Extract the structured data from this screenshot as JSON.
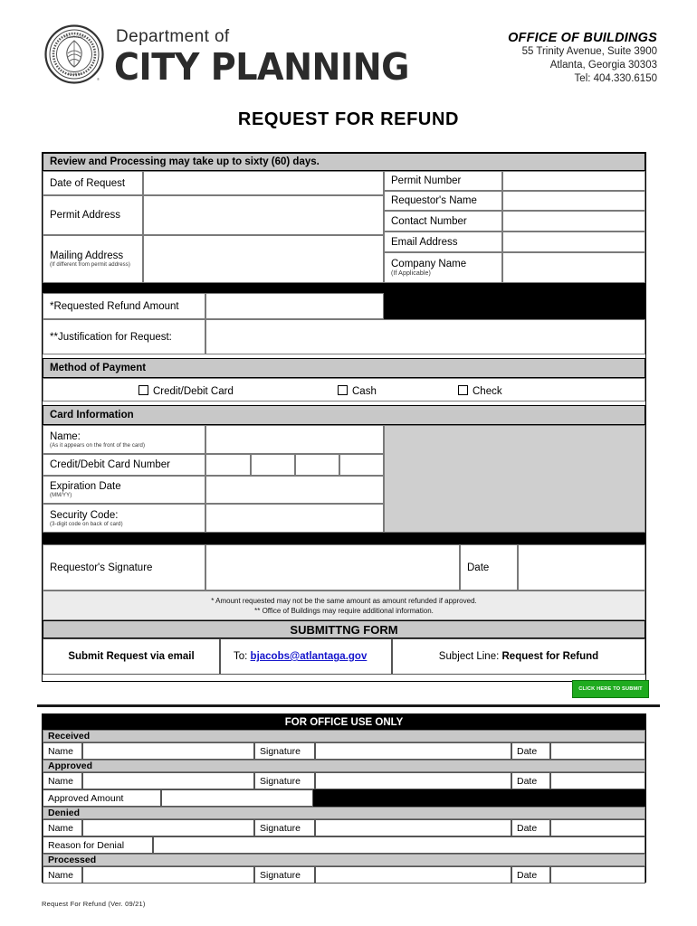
{
  "header": {
    "dept_line": "Department of",
    "dept_name": "CITY PLANNING",
    "seal_icon": "city-of-atlanta-seal-icon",
    "office_title": "OFFICE OF BUILDINGS",
    "address_line1": "55 Trinity Avenue, Suite 3900",
    "address_line2": "Atlanta, Georgia 30303",
    "phone": "Tel: 404.330.6150"
  },
  "form_title": "REQUEST FOR REFUND",
  "notice_band": "Review and Processing may take up to sixty (60) days.",
  "left_fields": [
    {
      "label": "Date of Request",
      "sub": "",
      "value": ""
    },
    {
      "label": "Permit Address",
      "sub": "",
      "value": ""
    },
    {
      "label": "Mailing Address",
      "sub": "(If different from permit address)",
      "value": ""
    }
  ],
  "right_fields": [
    {
      "label": "Permit Number",
      "sub": "",
      "value": ""
    },
    {
      "label": "Requestor's Name",
      "sub": "",
      "value": ""
    },
    {
      "label": "Contact Number",
      "sub": "",
      "value": ""
    },
    {
      "label": "Email Address",
      "sub": "",
      "value": ""
    },
    {
      "label": "Company Name",
      "sub": "(If Applicable)",
      "value": ""
    }
  ],
  "refund": {
    "amount_label": "*Requested Refund Amount",
    "amount_value": "",
    "justification_label": "**Justification for Request:",
    "justification_value": ""
  },
  "payment": {
    "band": "Method of Payment",
    "options": [
      {
        "label": "Credit/Debit Card",
        "checked": false
      },
      {
        "label": "Cash",
        "checked": false
      },
      {
        "label": "Check",
        "checked": false
      }
    ]
  },
  "card": {
    "band": "Card Information",
    "name_label": "Name:",
    "name_sub": "(As it appears on the front of the card)",
    "name_value": "",
    "number_label": "Credit/Debit Card Number",
    "number_groups": [
      "",
      "",
      "",
      ""
    ],
    "expiration_label": "Expiration Date",
    "expiration_sub": "(MM/YY)",
    "expiration_value": "",
    "security_label": "Security Code:",
    "security_sub": "(3-digit code on back of card)",
    "security_value": ""
  },
  "signature": {
    "label": "Requestor's Signature",
    "value": "",
    "date_label": "Date",
    "date_value": ""
  },
  "notes": {
    "note1": "* Amount requested may not be the same amount as amount refunded if approved.",
    "note2": "** Office of Buildings may require additional information."
  },
  "submitting": {
    "band": "SUBMITTNG FORM",
    "method": "Submit Request via email",
    "to_prefix": "To:",
    "to_email": "bjacobs@atlantaga.gov",
    "subject_prefix": "Subject Line:",
    "subject_value": "Request for Refund",
    "button_label": "CLICK HERE TO SUBMIT"
  },
  "office_use": {
    "title": "FOR OFFICE USE ONLY",
    "name_label": "Name",
    "signature_label": "Signature",
    "date_label": "Date",
    "sections": [
      {
        "band": "Received"
      },
      {
        "band": "Approved"
      },
      {
        "band": "Denied"
      },
      {
        "band": "Processed"
      }
    ],
    "approved_amount_label": "Approved Amount",
    "approved_amount_value": "",
    "reason_for_denial_label": "Reason for Denial",
    "reason_for_denial_value": ""
  },
  "footer": "Request For Refund    (Ver. 09/21)",
  "colors": {
    "band_grey": "#c8c8c8",
    "note_grey": "#ececec",
    "card_grey": "#cfcfcf",
    "black": "#000000",
    "submit_green": "#1fab1f",
    "link_blue": "#1414cc"
  }
}
